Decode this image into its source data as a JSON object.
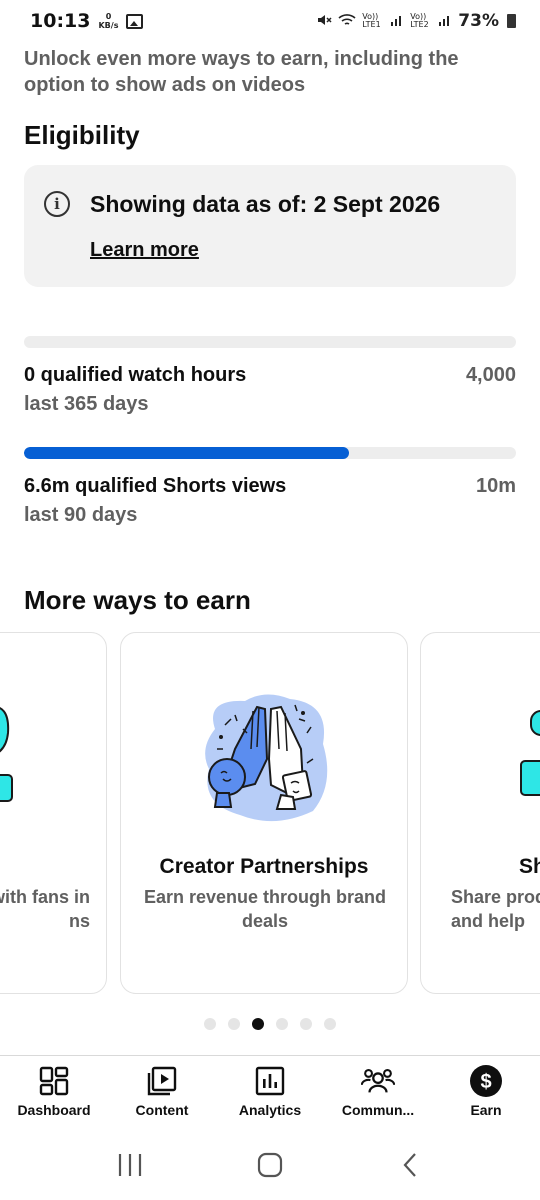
{
  "status_bar": {
    "time": "10:13",
    "net_speed_value": "0",
    "net_speed_unit": "KB/s",
    "signal_1": "Vo)) LTE1",
    "signal_2": "Vo)) LTE2",
    "battery": "73%"
  },
  "intro_text": "Unlock even more ways to earn, including the option to show ads on videos",
  "eligibility": {
    "title": "Eligibility",
    "info": "Showing data as of: 2 Sept 2026",
    "learn_more": "Learn more"
  },
  "metrics": [
    {
      "label": "0 qualified watch hours",
      "sub": "last 365 days",
      "target": "4,000",
      "progress": 0.0
    },
    {
      "label": "6.6m qualified Shorts views",
      "sub": "last 90 days",
      "target": "10m",
      "progress": 0.66
    }
  ],
  "more_ways": {
    "title": "More ways to earn",
    "cards": [
      {
        "title": "",
        "desc": "with fans in\nns"
      },
      {
        "title": "Creator Partnerships",
        "desc": "Earn revenue through brand deals"
      },
      {
        "title": "Sh",
        "desc": "Share produ\nand help"
      }
    ],
    "dot_count": 6,
    "active_dot": 2
  },
  "bottom_nav": [
    {
      "label": "Dashboard",
      "icon": "dashboard-icon"
    },
    {
      "label": "Content",
      "icon": "content-icon"
    },
    {
      "label": "Analytics",
      "icon": "analytics-icon"
    },
    {
      "label": "Commun...",
      "icon": "community-icon"
    },
    {
      "label": "Earn",
      "icon": "earn-icon"
    }
  ],
  "colors": {
    "accent": "#065fd4",
    "illustration_blue": "#5b8def",
    "illustration_cyan": "#2ee6e6"
  }
}
